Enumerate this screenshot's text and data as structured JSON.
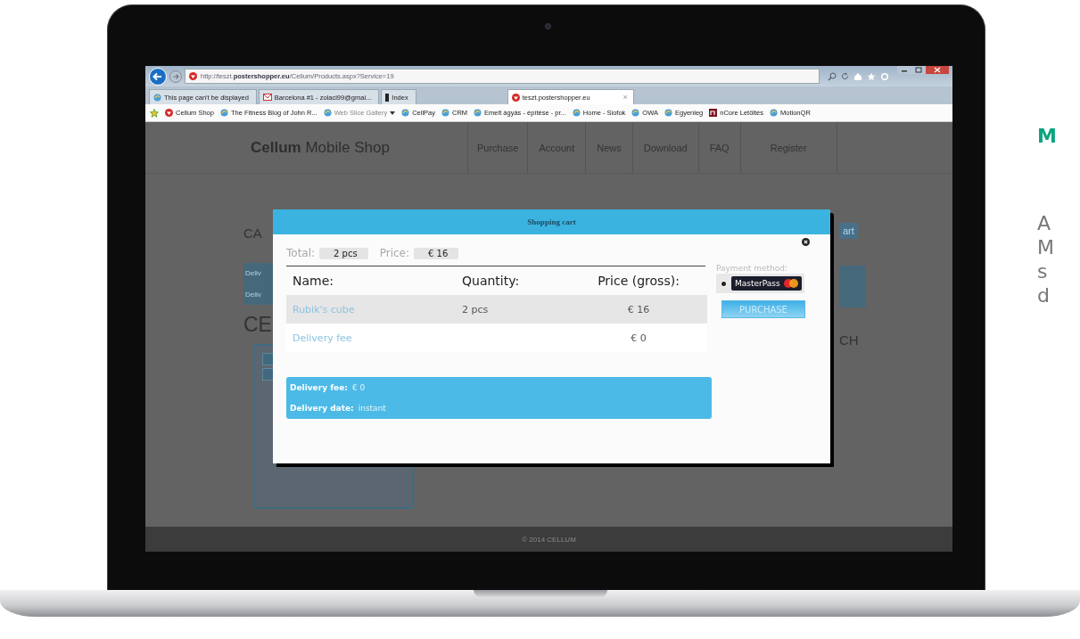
{
  "browser": {
    "address": {
      "url": "http://teszt.**postershopper.eu**/Cellum/Products.aspx?Service=19"
    },
    "tabs": [
      {
        "label": "This page can't be displayed",
        "kind": "page",
        "selected": false
      },
      {
        "label": "Barcelona #1 - zolaci99@gmai...",
        "kind": "mail",
        "selected": false
      },
      {
        "label": "Index",
        "kind": "bar",
        "selected": false
      },
      {
        "label": "teszt.postershopper.eu",
        "kind": "logo",
        "selected": true,
        "close": "×"
      }
    ],
    "favorites": [
      {
        "label": "Cellum Shop",
        "kind": "logo"
      },
      {
        "label": "The Fitness Blog of John R...",
        "kind": "page"
      },
      {
        "label": "Web Slice Gallery",
        "kind": "page",
        "dropdown": true
      },
      {
        "label": "CellPay",
        "kind": "page"
      },
      {
        "label": "CRM",
        "kind": "page"
      },
      {
        "label": "Emelt ágyás - építése - pr...",
        "kind": "page"
      },
      {
        "label": "Home - Siofok",
        "kind": "page"
      },
      {
        "label": "OWA",
        "kind": "page"
      },
      {
        "label": "Egyenleg",
        "kind": "page"
      },
      {
        "label": "nCore Letöltés",
        "kind": "square"
      },
      {
        "label": "MotionQR",
        "kind": "page"
      }
    ]
  },
  "site": {
    "logo": "**Cellum** Mobile Shop",
    "nav": [
      "Purchase",
      "Account",
      "News",
      "Download",
      "FAQ",
      "Register"
    ],
    "behind": {
      "cart_heading": "CA",
      "delivery_lines": [
        "Deliv",
        "Deliv"
      ],
      "product_heading": "CE",
      "cart_button": "art",
      "search_heading": "CH"
    },
    "footer": "© 2014 CELLUM"
  },
  "cart": {
    "title": "Shopping cart",
    "total_label": "Total:",
    "total_value": "2 pcs",
    "price_label": "Price:",
    "price_value": "€ 16",
    "columns": [
      "Name:",
      "Quantity:",
      "Price (gross):"
    ],
    "rows": [
      {
        "name": "Rubik's cube",
        "quantity": "2 pcs",
        "price": "€ 16",
        "highlighted": true
      },
      {
        "name": "Delivery fee",
        "price": "€ 0",
        "highlighted": false
      }
    ],
    "summary": [
      {
        "label": "Delivery fee:",
        "value": "€ 0"
      },
      {
        "label": "Delivery date:",
        "value": "instant"
      }
    ],
    "payment": {
      "label": "Payment method:",
      "options": [
        {
          "label": "MasterPass",
          "selected": true
        }
      ]
    },
    "purchase": "PURCHASE"
  },
  "side": {
    "heading": "M",
    "lines": [
      "A",
      "M",
      "s",
      "d"
    ]
  }
}
